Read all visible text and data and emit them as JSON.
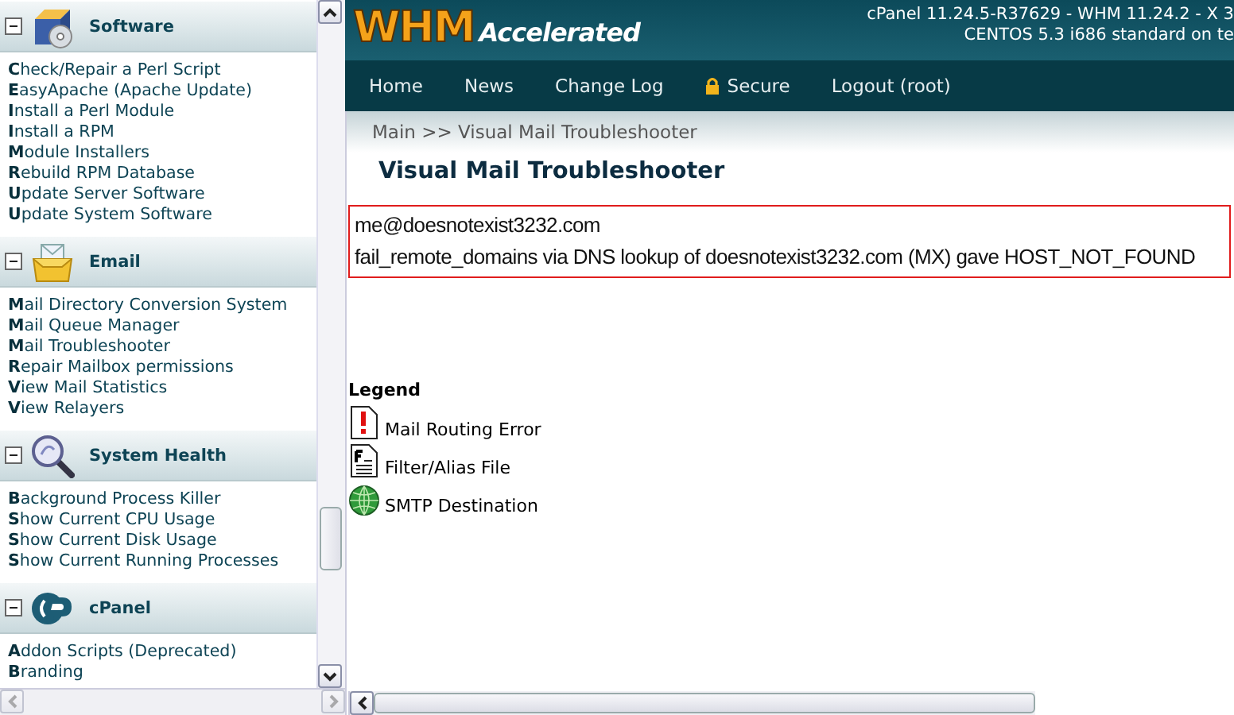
{
  "sidebar": {
    "sections": [
      {
        "title": "Software",
        "expanded": true,
        "items": [
          "**C**heck/Repair a Perl Script",
          "**E**asyApache (Apache Update)",
          "**I**nstall a Perl Module",
          "**I**nstall a RPM",
          "**M**odule Installers",
          "**R**ebuild RPM Database",
          "**U**pdate Server Software",
          "**U**pdate System Software"
        ]
      },
      {
        "title": "Email",
        "expanded": true,
        "items": [
          "**M**ail Directory Conversion System",
          "**M**ail Queue Manager",
          "**M**ail Troubleshooter",
          "**R**epair Mailbox permissions",
          "**V**iew Mail Statistics",
          "**V**iew Relayers"
        ]
      },
      {
        "title": "System Health",
        "expanded": true,
        "items": [
          "**B**ackground Process Killer",
          "**S**how Current CPU Usage",
          "**S**how Current Disk Usage",
          "**S**how Current Running Processes"
        ]
      },
      {
        "title": "cPanel",
        "expanded": true,
        "items": [
          "**A**ddon Scripts (Deprecated)",
          "**B**randing"
        ]
      }
    ]
  },
  "header": {
    "logo_main": "WHM",
    "logo_sub": "Accelerated",
    "version_lines": [
      "cPanel 11.24.5-R37629 - WHM 11.24.2 - X 3",
      "CENTOS 5.3 i686 standard on te"
    ]
  },
  "nav": [
    {
      "label": "Home",
      "kind": "link"
    },
    {
      "label": "News",
      "kind": "link"
    },
    {
      "label": "Change Log",
      "kind": "link"
    },
    {
      "label": "Secure",
      "kind": "lock-link"
    },
    {
      "label": "Logout (root)",
      "kind": "link"
    }
  ],
  "breadcrumb": "Main >> Visual Mail Troubleshooter",
  "page_title": "Visual Mail Troubleshooter",
  "result": {
    "address": "me@doesnotexist3232.com",
    "message": "fail_remote_domains via DNS lookup of doesnotexist3232.com (MX) gave HOST_NOT_FOUND"
  },
  "legend": {
    "title": "Legend",
    "items": [
      "Mail Routing Error",
      "Filter/Alias File",
      "SMTP Destination"
    ]
  }
}
